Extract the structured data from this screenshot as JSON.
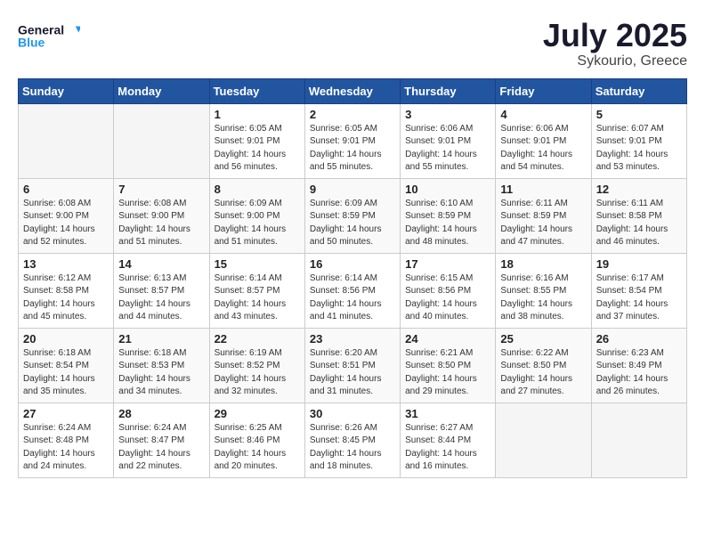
{
  "logo": {
    "line1": "General",
    "line2": "Blue"
  },
  "title": "July 2025",
  "location": "Sykourio, Greece",
  "days_of_week": [
    "Sunday",
    "Monday",
    "Tuesday",
    "Wednesday",
    "Thursday",
    "Friday",
    "Saturday"
  ],
  "weeks": [
    [
      {
        "day": "",
        "info": ""
      },
      {
        "day": "",
        "info": ""
      },
      {
        "day": "1",
        "info": "Sunrise: 6:05 AM\nSunset: 9:01 PM\nDaylight: 14 hours and 56 minutes."
      },
      {
        "day": "2",
        "info": "Sunrise: 6:05 AM\nSunset: 9:01 PM\nDaylight: 14 hours and 55 minutes."
      },
      {
        "day": "3",
        "info": "Sunrise: 6:06 AM\nSunset: 9:01 PM\nDaylight: 14 hours and 55 minutes."
      },
      {
        "day": "4",
        "info": "Sunrise: 6:06 AM\nSunset: 9:01 PM\nDaylight: 14 hours and 54 minutes."
      },
      {
        "day": "5",
        "info": "Sunrise: 6:07 AM\nSunset: 9:01 PM\nDaylight: 14 hours and 53 minutes."
      }
    ],
    [
      {
        "day": "6",
        "info": "Sunrise: 6:08 AM\nSunset: 9:00 PM\nDaylight: 14 hours and 52 minutes."
      },
      {
        "day": "7",
        "info": "Sunrise: 6:08 AM\nSunset: 9:00 PM\nDaylight: 14 hours and 51 minutes."
      },
      {
        "day": "8",
        "info": "Sunrise: 6:09 AM\nSunset: 9:00 PM\nDaylight: 14 hours and 51 minutes."
      },
      {
        "day": "9",
        "info": "Sunrise: 6:09 AM\nSunset: 8:59 PM\nDaylight: 14 hours and 50 minutes."
      },
      {
        "day": "10",
        "info": "Sunrise: 6:10 AM\nSunset: 8:59 PM\nDaylight: 14 hours and 48 minutes."
      },
      {
        "day": "11",
        "info": "Sunrise: 6:11 AM\nSunset: 8:59 PM\nDaylight: 14 hours and 47 minutes."
      },
      {
        "day": "12",
        "info": "Sunrise: 6:11 AM\nSunset: 8:58 PM\nDaylight: 14 hours and 46 minutes."
      }
    ],
    [
      {
        "day": "13",
        "info": "Sunrise: 6:12 AM\nSunset: 8:58 PM\nDaylight: 14 hours and 45 minutes."
      },
      {
        "day": "14",
        "info": "Sunrise: 6:13 AM\nSunset: 8:57 PM\nDaylight: 14 hours and 44 minutes."
      },
      {
        "day": "15",
        "info": "Sunrise: 6:14 AM\nSunset: 8:57 PM\nDaylight: 14 hours and 43 minutes."
      },
      {
        "day": "16",
        "info": "Sunrise: 6:14 AM\nSunset: 8:56 PM\nDaylight: 14 hours and 41 minutes."
      },
      {
        "day": "17",
        "info": "Sunrise: 6:15 AM\nSunset: 8:56 PM\nDaylight: 14 hours and 40 minutes."
      },
      {
        "day": "18",
        "info": "Sunrise: 6:16 AM\nSunset: 8:55 PM\nDaylight: 14 hours and 38 minutes."
      },
      {
        "day": "19",
        "info": "Sunrise: 6:17 AM\nSunset: 8:54 PM\nDaylight: 14 hours and 37 minutes."
      }
    ],
    [
      {
        "day": "20",
        "info": "Sunrise: 6:18 AM\nSunset: 8:54 PM\nDaylight: 14 hours and 35 minutes."
      },
      {
        "day": "21",
        "info": "Sunrise: 6:18 AM\nSunset: 8:53 PM\nDaylight: 14 hours and 34 minutes."
      },
      {
        "day": "22",
        "info": "Sunrise: 6:19 AM\nSunset: 8:52 PM\nDaylight: 14 hours and 32 minutes."
      },
      {
        "day": "23",
        "info": "Sunrise: 6:20 AM\nSunset: 8:51 PM\nDaylight: 14 hours and 31 minutes."
      },
      {
        "day": "24",
        "info": "Sunrise: 6:21 AM\nSunset: 8:50 PM\nDaylight: 14 hours and 29 minutes."
      },
      {
        "day": "25",
        "info": "Sunrise: 6:22 AM\nSunset: 8:50 PM\nDaylight: 14 hours and 27 minutes."
      },
      {
        "day": "26",
        "info": "Sunrise: 6:23 AM\nSunset: 8:49 PM\nDaylight: 14 hours and 26 minutes."
      }
    ],
    [
      {
        "day": "27",
        "info": "Sunrise: 6:24 AM\nSunset: 8:48 PM\nDaylight: 14 hours and 24 minutes."
      },
      {
        "day": "28",
        "info": "Sunrise: 6:24 AM\nSunset: 8:47 PM\nDaylight: 14 hours and 22 minutes."
      },
      {
        "day": "29",
        "info": "Sunrise: 6:25 AM\nSunset: 8:46 PM\nDaylight: 14 hours and 20 minutes."
      },
      {
        "day": "30",
        "info": "Sunrise: 6:26 AM\nSunset: 8:45 PM\nDaylight: 14 hours and 18 minutes."
      },
      {
        "day": "31",
        "info": "Sunrise: 6:27 AM\nSunset: 8:44 PM\nDaylight: 14 hours and 16 minutes."
      },
      {
        "day": "",
        "info": ""
      },
      {
        "day": "",
        "info": ""
      }
    ]
  ]
}
